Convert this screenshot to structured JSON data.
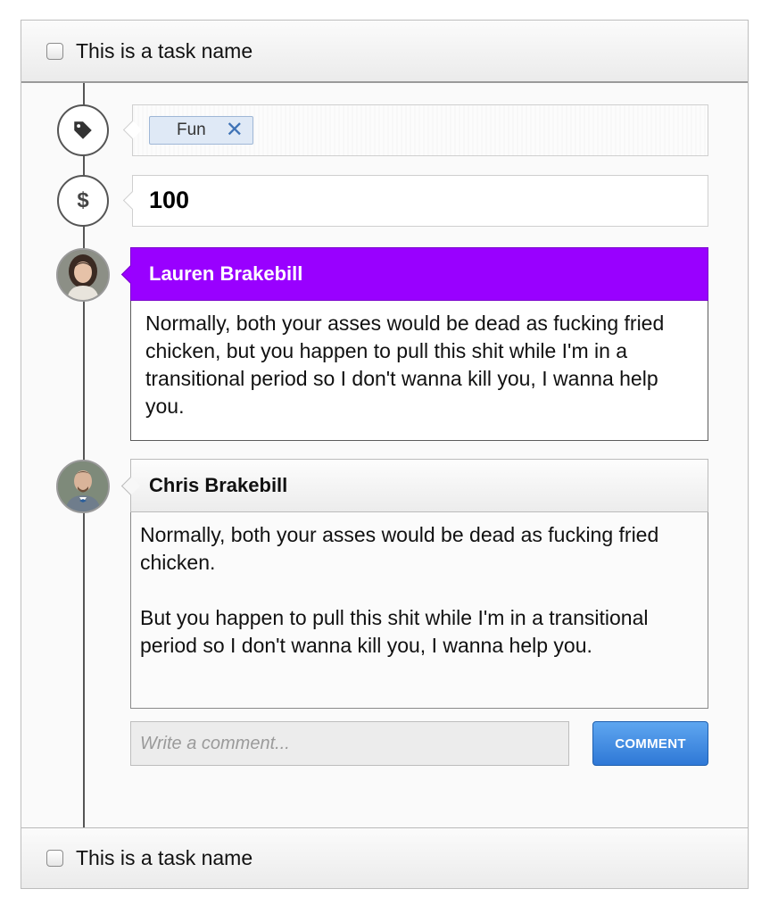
{
  "task_header": {
    "name": "This is a task name",
    "checked": false
  },
  "tags_field": {
    "tags": [
      {
        "label": "Fun",
        "remove_glyph": "✕"
      }
    ]
  },
  "value_field": {
    "currency_symbol": "$",
    "value": "100"
  },
  "comments": [
    {
      "author": "Lauren Brakebill",
      "header_color": "#9900ff",
      "paragraphs": [
        "Normally, both your asses would be dead as fucking fried chicken, but you happen to pull this shit while I'm in a transitional period so I don't wanna kill you, I wanna help you."
      ]
    },
    {
      "author": "Chris Brakebill",
      "paragraphs": [
        "Normally, both your asses would be dead as fucking fried chicken.",
        "But you happen to pull this shit while I'm in a transitional period so I don't wanna kill you, I wanna help you."
      ]
    }
  ],
  "composer": {
    "placeholder": "Write a comment...",
    "button_label": "COMMENT",
    "button_color": "#2f78d6"
  },
  "task_footer": {
    "name": "This is a task name",
    "checked": false
  },
  "icons": {
    "tag": "tag-icon",
    "dollar": "dollar-icon",
    "close": "close-icon"
  }
}
